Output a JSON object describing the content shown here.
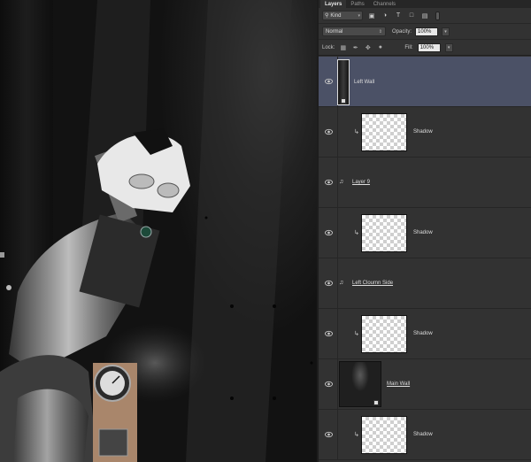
{
  "panel": {
    "tabs": [
      {
        "label": "Layers"
      },
      {
        "label": "Paths"
      },
      {
        "label": "Channels"
      }
    ],
    "filter": {
      "kind_label": "Kind"
    },
    "blend_mode": "Normal",
    "opacity_label": "Opacity:",
    "opacity_value": "100%",
    "lock_label": "Lock:",
    "fill_label": "Fill:",
    "fill_value": "100%"
  },
  "layers": [
    {
      "name": "Left Wall",
      "selected": true,
      "kind": "smart-object",
      "clipped": false
    },
    {
      "name": "Shadow",
      "selected": false,
      "kind": "pixel",
      "clipped": true
    },
    {
      "name": "Layer 9",
      "selected": false,
      "kind": "linked",
      "clipped": false
    },
    {
      "name": "Shadow",
      "selected": false,
      "kind": "pixel",
      "clipped": true
    },
    {
      "name": "Left Cloumn Side",
      "selected": false,
      "kind": "linked",
      "clipped": false
    },
    {
      "name": "Shadow",
      "selected": false,
      "kind": "pixel",
      "clipped": true
    },
    {
      "name": "Main Wall",
      "selected": false,
      "kind": "smart-object",
      "clipped": false
    },
    {
      "name": "Shadow",
      "selected": false,
      "kind": "pixel",
      "clipped": true
    }
  ],
  "colors": {
    "panel_bg": "#323232",
    "selected_row": "#4b5166",
    "canvas_bg": "#1a1a1a"
  }
}
